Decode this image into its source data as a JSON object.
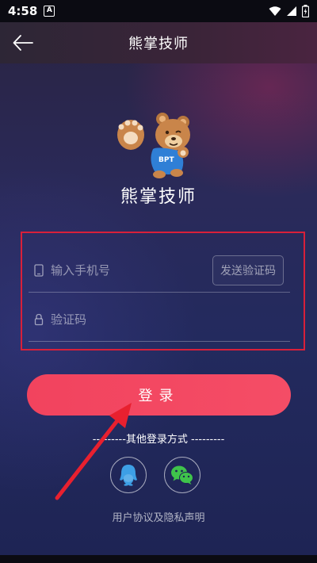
{
  "status_bar": {
    "time": "4:58",
    "notification": "A"
  },
  "app_bar": {
    "title": "熊掌技师"
  },
  "logo": {
    "badge_text": "BPT",
    "app_name": "熊掌技师"
  },
  "form": {
    "phone_placeholder": "输入手机号",
    "send_code_label": "发送验证码",
    "code_placeholder": "验证码"
  },
  "login_label": "登录",
  "other_login_text": "---------其他登录方式 ---------",
  "social": [
    {
      "name": "qq-icon"
    },
    {
      "name": "wechat-icon"
    }
  ],
  "agreement_text": "用户协议及隐私声明",
  "colors": {
    "accent": "#f2435e",
    "annotation": "#e8202f",
    "wechat": "#3fc34b",
    "qq": "#3d9fe6"
  }
}
